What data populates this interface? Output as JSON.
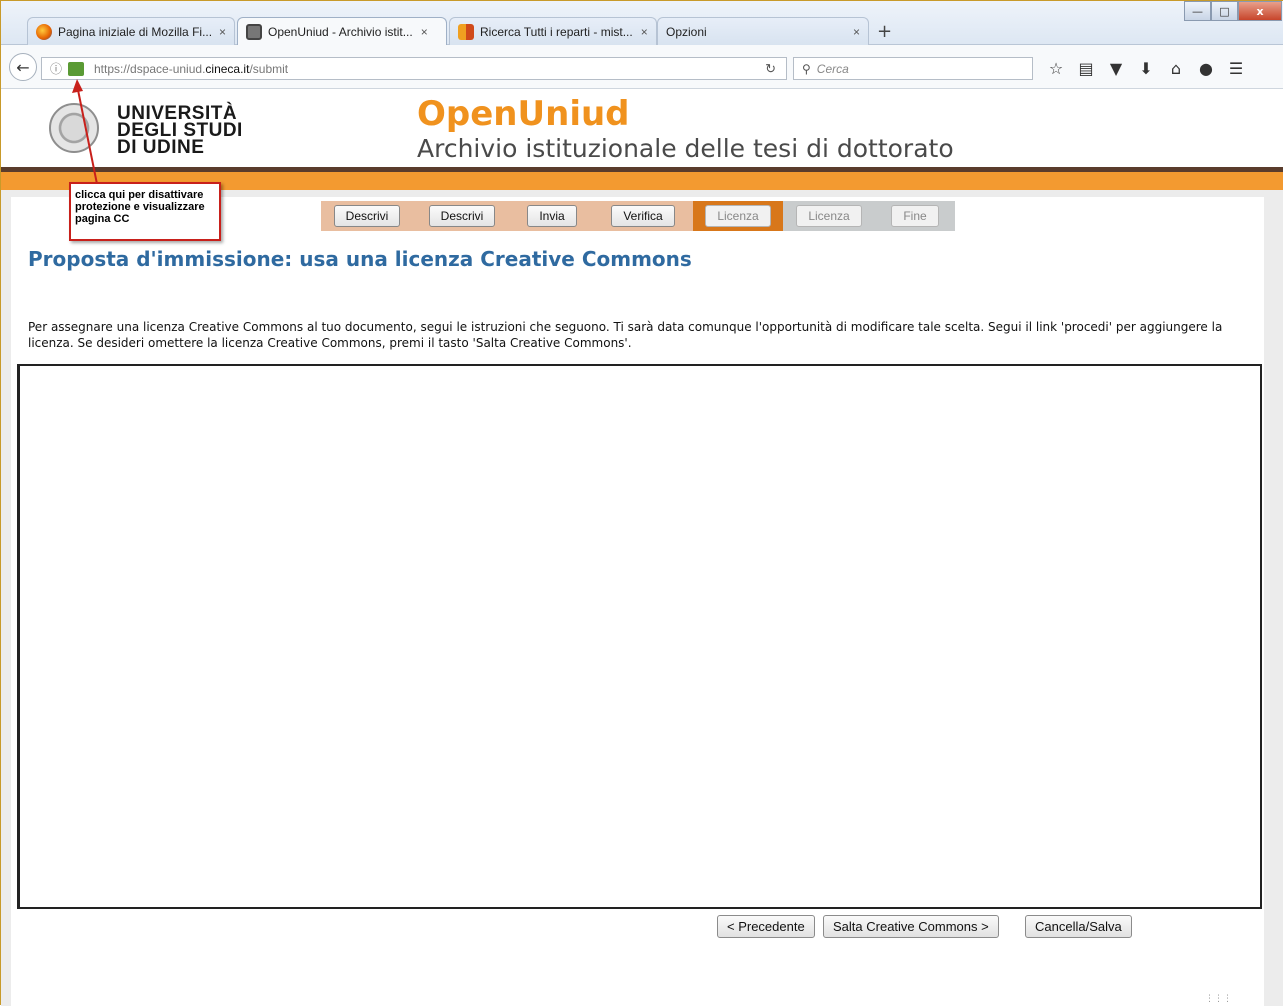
{
  "browser": {
    "tabs": [
      {
        "title": "Pagina iniziale di Mozilla Fi...",
        "favicon_color": "#e66000",
        "active": false
      },
      {
        "title": "OpenUniud - Archivio istit...",
        "favicon_color": "#6b6b6b",
        "active": true
      },
      {
        "title": "Ricerca Tutti i reparti - mist...",
        "favicon_color": "#f0a020",
        "active": false
      },
      {
        "title": "Opzioni",
        "favicon_color": "",
        "active": false
      }
    ],
    "close_glyph": "×",
    "new_tab_glyph": "+",
    "window_controls": {
      "minimize": "—",
      "maximize": "□",
      "close": "x"
    },
    "url_prefix": "https://dspace-uniud.",
    "url_domain": "cineca.it",
    "url_path": "/submit",
    "search_placeholder": "Cerca",
    "toolbar_icons": [
      "star-icon",
      "reading-list-icon",
      "pocket-icon",
      "download-icon",
      "home-icon",
      "chat-icon",
      "menu-icon"
    ]
  },
  "header": {
    "university": [
      "UNIVERSITÀ",
      "DEGLI STUDI",
      "DI UDINE"
    ],
    "site_title": "OpenUniud",
    "site_subtitle": "Archivio istituzionale delle tesi di dottorato"
  },
  "progress": {
    "steps": [
      {
        "label": "Descrivi",
        "state": "done"
      },
      {
        "label": "Descrivi",
        "state": "done"
      },
      {
        "label": "Invia",
        "state": "done"
      },
      {
        "label": "Verifica",
        "state": "done"
      },
      {
        "label": "Licenza",
        "state": "current"
      },
      {
        "label": "Licenza",
        "state": "todo"
      },
      {
        "label": "Fine",
        "state": "todo"
      }
    ]
  },
  "main": {
    "heading": "Proposta d'immissione: usa una licenza Creative Commons",
    "intro": "Per assegnare una licenza Creative Commons al tuo documento, segui le istruzioni che seguono. Ti sarà data comunque l'opportunità di modificare tale scelta. Segui il link 'procedi' per aggiungere la licenza. Se desideri omettere la licenza Creative Commons, premi il tasto 'Salta Creative Commons'.",
    "buttons": {
      "previous": "< Precedente",
      "skip_cc": "Salta Creative Commons >",
      "cancel_save": "Cancella/Salva"
    }
  },
  "annotation": {
    "text": "clicca qui per disattivare protezione e visualizzare pagina CC",
    "color": "#c8201b"
  },
  "colors": {
    "accent_orange": "#f39a30",
    "title_orange": "#f0921e",
    "heading_blue": "#2f6aa0",
    "step_done": "#e9bea0",
    "step_current": "#d8771a",
    "step_todo": "#c9cccd"
  }
}
